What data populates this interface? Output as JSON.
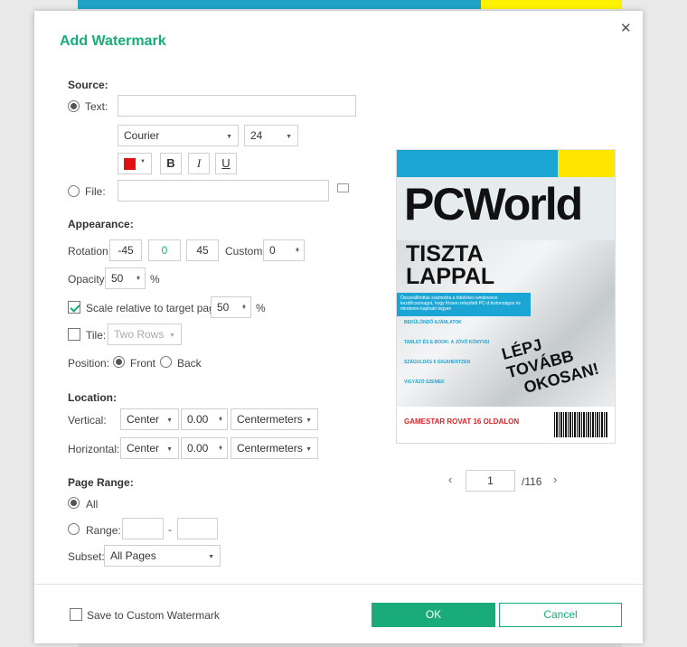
{
  "dialog": {
    "title": "Add Watermark",
    "close_icon": "✕"
  },
  "source": {
    "heading": "Source:",
    "text_label": "Text:",
    "text_value": "",
    "font": "Courier",
    "font_size": "24",
    "color": "#e01010",
    "bold_label": "B",
    "italic_label": "I",
    "underline_label": "U",
    "file_label": "File:",
    "file_value": ""
  },
  "appearance": {
    "heading": "Appearance:",
    "rotation_label": "Rotation:",
    "rotation_options": [
      "-45",
      "0",
      "45"
    ],
    "custom_label": "Custom:",
    "custom_value": "0",
    "opacity_label": "Opacity:",
    "opacity_value": "50",
    "percent": "%",
    "scale_label": "Scale relative to target page:",
    "scale_value": "50",
    "tile_label": "Tile:",
    "tile_value": "Two Rows",
    "position_label": "Position:",
    "front_label": "Front",
    "back_label": "Back"
  },
  "location": {
    "heading": "Location:",
    "vertical_label": "Vertical:",
    "vertical_align": "Center",
    "vertical_offset": "0.00",
    "vertical_unit": "Centermeters",
    "horizontal_label": "Horizontal:",
    "horizontal_align": "Center",
    "horizontal_offset": "0.00",
    "horizontal_unit": "Centermeters"
  },
  "page_range": {
    "heading": "Page Range:",
    "all_label": "All",
    "range_label": "Range:",
    "range_from": "",
    "range_dash": "-",
    "range_to": "",
    "subset_label": "Subset:",
    "subset_value": "All Pages"
  },
  "preview": {
    "masthead": "PCWorld",
    "headline_line1": "TISZTA",
    "headline_line2": "LAPPAL",
    "stamp_line1": "LÉPJ TOVÁBB",
    "stamp_line2": "OKOSAN!",
    "blurb": "Összeállítottuk számodra a tökéletes windowsos kezdőcsomagot, hogy frissen telepített PC-d biztonságos és mindenre kapható legyen",
    "items": [
      "BEKÜLÖNDŐ AJÁNLATOK",
      "TABLET ÉS E-BOOK: A JÖVŐ KÖNYVEI",
      "SZÁGULDÁS 6 GIGAHERTZEN",
      "VIGYÁZÓ SZEMEK"
    ],
    "gamestar": "GAMESTAR ROVAT 16 OLDALON",
    "current_page": "1",
    "total_pages": "/116",
    "prev_icon": "‹",
    "next_icon": "›"
  },
  "footer": {
    "save_label": "Save to Custom Watermark",
    "ok_label": "OK",
    "cancel_label": "Cancel",
    "accent": "#1aab7a"
  }
}
